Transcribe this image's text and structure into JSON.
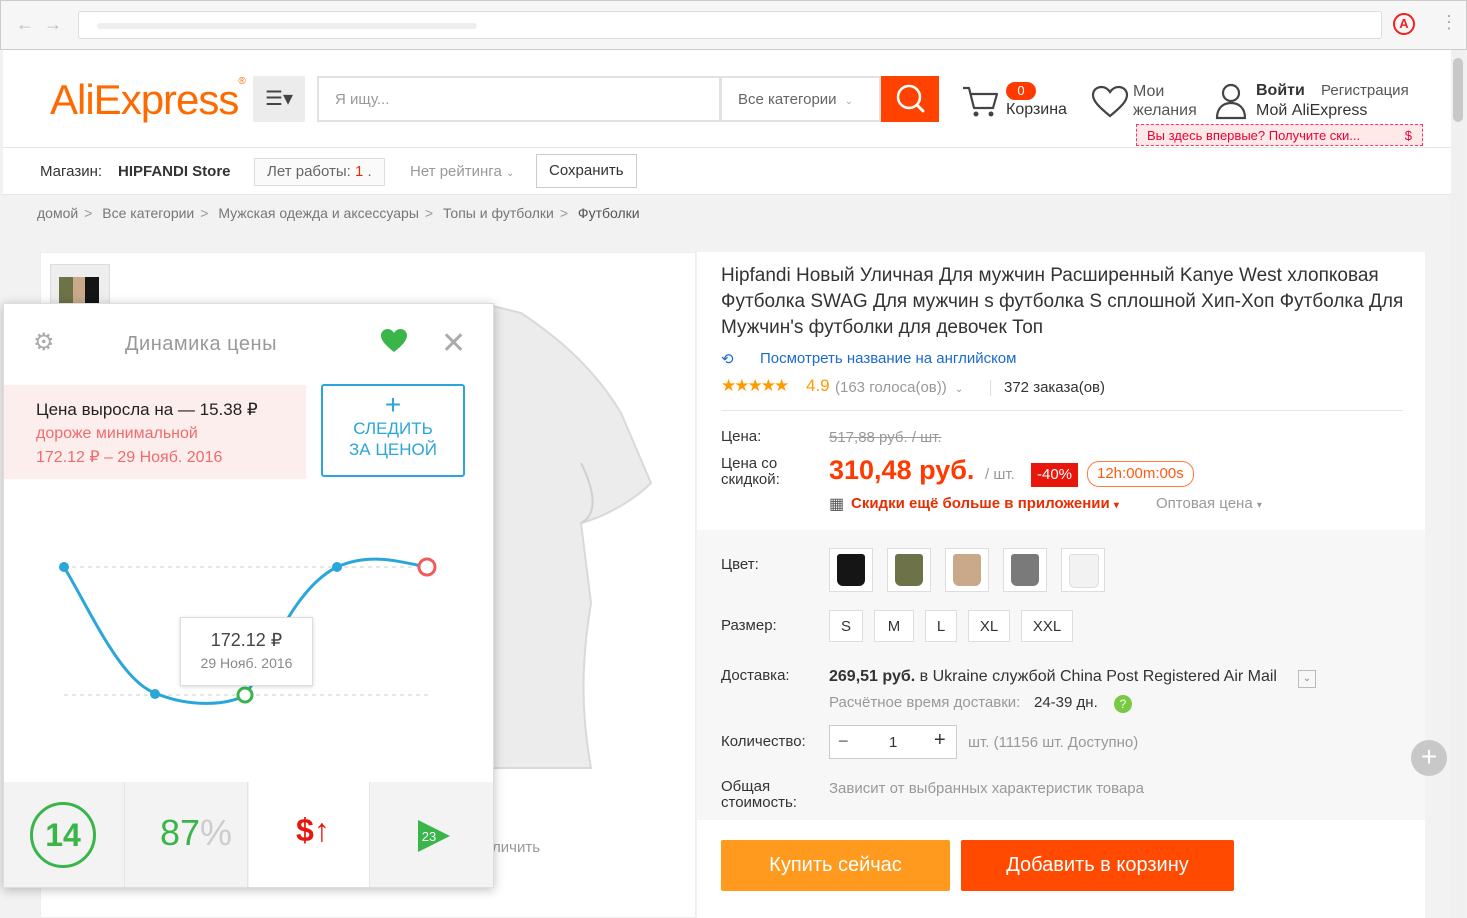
{
  "browser": {
    "back": "←",
    "forward": "→",
    "extension_letter": "A"
  },
  "header": {
    "logo": "AliExpress",
    "logo_tm": "®",
    "menu_icon": "☰▾",
    "search_placeholder": "Я ищу...",
    "category_select": "Все категории",
    "cart_count": "0",
    "cart_label": "Корзина",
    "wishlist_line1": "Мои",
    "wishlist_line2": "желания",
    "signin": "Войти",
    "register": "Регистрация",
    "my_account": "Мой AliExpress",
    "promo": "Вы здесь впервые? Получите ски...",
    "promo_icon": "$"
  },
  "store": {
    "prefix": "Магазин:",
    "name": "HIPFANDI Store",
    "years_label": "Лет работы:",
    "years_value": "1",
    "years_suffix": ".",
    "rating": "Нет рейтинга",
    "save": "Сохранить"
  },
  "breadcrumb": [
    "домой",
    "Все категории",
    "Мужская одежда и аксессуары",
    "Топы и футболки",
    "Футболки"
  ],
  "gallery": {
    "zoom_label": "личить"
  },
  "product": {
    "title": "Hipfandi Новый Уличная Для мужчин Расширенный Kanye West хлопковая Футболка SWAG Для мужчин s футболка S сплошной Хип-Хоп Футболка Для Мужчин's футболки для девочек Топ",
    "translate": "Посмотреть название на английском",
    "stars": "★★★★★",
    "score": "4.9",
    "votes": "(163 голоса(ов))",
    "orders": "372 заказа(ов)",
    "price_label": "Цена:",
    "old_price": "517,88 руб. / шт.",
    "discount_label": "Цена со скидкой:",
    "new_price": "310,48 руб.",
    "per_unit": "/ шт.",
    "discount_badge": "-40%",
    "timer": "12h:00m:00s",
    "app_promo": "Скидки ещё больше в приложении",
    "wholesale": "Оптовая цена",
    "color_label": "Цвет:",
    "colors": [
      "#151515",
      "#6e7248",
      "#c9a98a",
      "#7a7a7a",
      "#f2f2f2"
    ],
    "size_label": "Размер:",
    "sizes": [
      "S",
      "M",
      "L",
      "XL",
      "XXL"
    ],
    "shipping_label": "Доставка:",
    "shipping_price": "269,51 руб.",
    "shipping_rest": "в Ukraine службой China Post Registered Air Mail",
    "eta_label": "Расчётное время доставки:",
    "eta_value": "24-39 дн.",
    "qty_label": "Количество:",
    "qty_value": "1",
    "qty_available": "шт. (11156 шт. Доступно)",
    "total_label": "Общая стоимость:",
    "total_value": "Зависит от выбранных характеристик товара",
    "buy": "Купить сейчас",
    "add_to_cart": "Добавить в корзину"
  },
  "price_widget": {
    "title": "Динамика цены",
    "rise": "Цена выросла на — 15.38 ₽",
    "note_line1": "дороже минимальной",
    "note_line2": "172.12 ₽ – 29 Нояб. 2016",
    "track_plus": "+",
    "track_line1": "СЛЕДИТЬ",
    "track_line2": "ЗА ЦЕНОЙ",
    "tooltip_price": "172.12 ₽",
    "tooltip_date": "29 Нояб. 2016",
    "footer_score": "14",
    "footer_pct": "87",
    "footer_pct_sign": "%",
    "footer_dollar": "$↑",
    "footer_play_num": "23"
  },
  "colors": {
    "accent": "#ff4a00",
    "buy": "#ff9a1f",
    "price": "#ff3a00",
    "widget_blue": "#2aa6d8",
    "widget_green": "#39b54a"
  }
}
